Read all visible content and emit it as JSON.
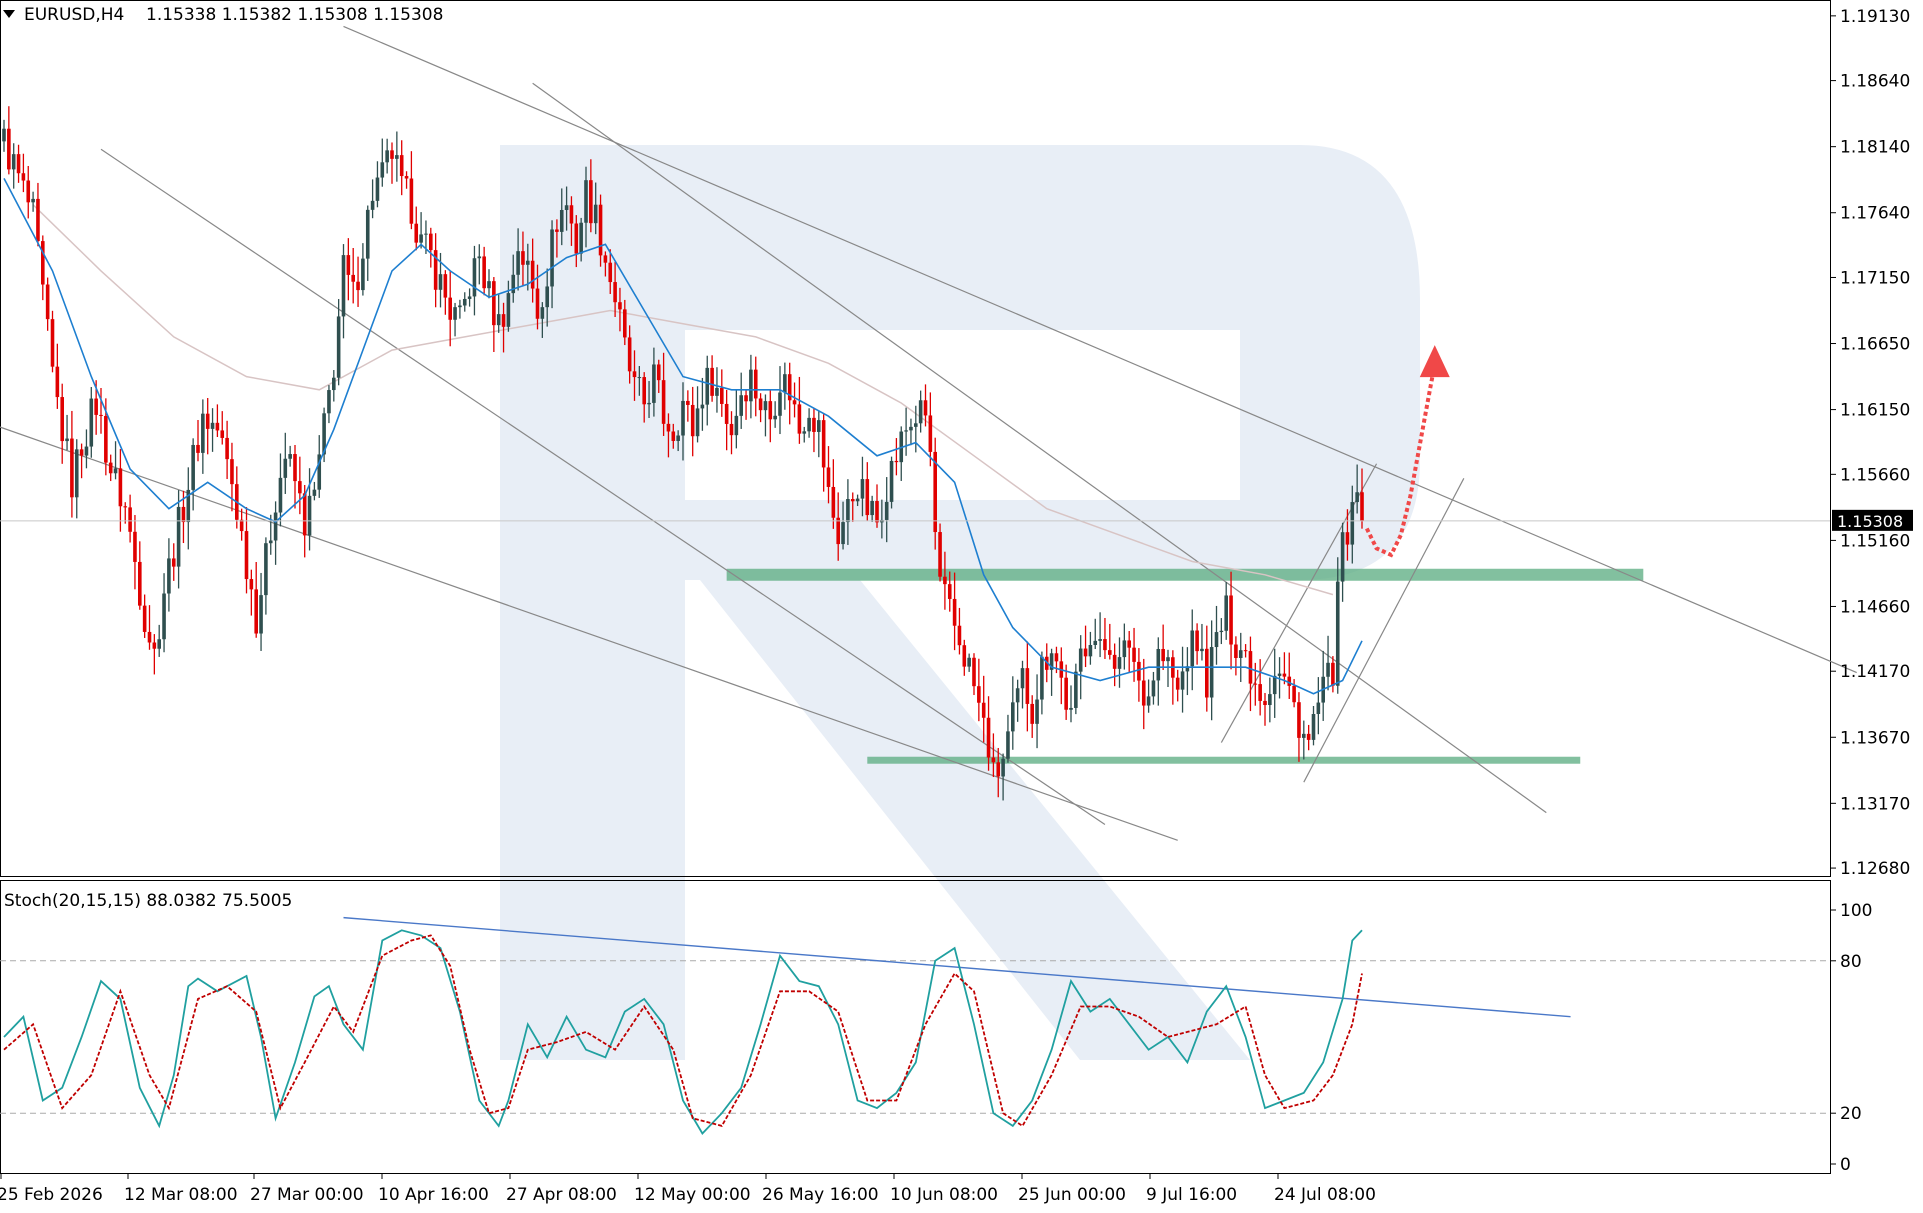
{
  "header": {
    "symbol": "EURUSD,H4",
    "ohlc": "1.15338 1.15382 1.15308 1.15308"
  },
  "colors": {
    "bull": "#2f4f4f",
    "bear": "#e00000",
    "ma_fast": "#1e7fd0",
    "ma_slow": "#d8c4c4",
    "zone": "#5fae84",
    "trend": "#888888",
    "forecast": "#f04848",
    "stoch_main": "#20a0a0",
    "stoch_signal": "#c00000",
    "stoch_trend": "#4a78c8",
    "watermark": "#e8eef6"
  },
  "chart_data": [
    {
      "type": "candlestick",
      "symbol": "EURUSD",
      "timeframe": "H4",
      "x_ticks": [
        "25 Feb 2026",
        "12 Mar 08:00",
        "27 Mar 00:00",
        "10 Apr 16:00",
        "27 Apr 08:00",
        "12 May 00:00",
        "26 May 16:00",
        "10 Jun 08:00",
        "25 Jun 00:00",
        "9 Jul 16:00",
        "24 Jul 08:00"
      ],
      "y_ticks": [
        "1.19130",
        "1.18640",
        "1.18140",
        "1.17640",
        "1.17150",
        "1.16650",
        "1.16150",
        "1.15660",
        "1.15160",
        "1.14660",
        "1.14170",
        "1.13670",
        "1.13170",
        "1.12680"
      ],
      "ylim": [
        1.1262,
        1.1925
      ],
      "current_price": "1.15308",
      "close_path": [
        [
          0,
          1.1818
        ],
        [
          3,
          1.179
        ],
        [
          6,
          1.176
        ],
        [
          8,
          1.17
        ],
        [
          10,
          1.164
        ],
        [
          12,
          1.16
        ],
        [
          14,
          1.156
        ],
        [
          16,
          1.159
        ],
        [
          19,
          1.162
        ],
        [
          22,
          1.157
        ],
        [
          25,
          1.154
        ],
        [
          27,
          1.15
        ],
        [
          29,
          1.146
        ],
        [
          31,
          1.143
        ],
        [
          33,
          1.148
        ],
        [
          35,
          1.151
        ],
        [
          38,
          1.156
        ],
        [
          41,
          1.161
        ],
        [
          44,
          1.16
        ],
        [
          47,
          1.156
        ],
        [
          50,
          1.15
        ],
        [
          52,
          1.146
        ],
        [
          54,
          1.15
        ],
        [
          56,
          1.155
        ],
        [
          58,
          1.158
        ],
        [
          60,
          1.156
        ],
        [
          62,
          1.153
        ],
        [
          64,
          1.155
        ],
        [
          66,
          1.16
        ],
        [
          68,
          1.165
        ],
        [
          70,
          1.172
        ],
        [
          72,
          1.17
        ],
        [
          74,
          1.174
        ],
        [
          76,
          1.178
        ],
        [
          78,
          1.179
        ],
        [
          80,
          1.181
        ],
        [
          82,
          1.178
        ],
        [
          84,
          1.177
        ],
        [
          86,
          1.174
        ],
        [
          88,
          1.173
        ],
        [
          90,
          1.171
        ],
        [
          92,
          1.169
        ],
        [
          94,
          1.168
        ],
        [
          96,
          1.171
        ],
        [
          98,
          1.173
        ],
        [
          100,
          1.17
        ],
        [
          102,
          1.168
        ],
        [
          104,
          1.17
        ],
        [
          106,
          1.174
        ],
        [
          108,
          1.172
        ],
        [
          110,
          1.169
        ],
        [
          112,
          1.172
        ],
        [
          114,
          1.176
        ],
        [
          116,
          1.177
        ],
        [
          118,
          1.174
        ],
        [
          120,
          1.178
        ],
        [
          122,
          1.176
        ],
        [
          124,
          1.173
        ],
        [
          126,
          1.17
        ],
        [
          128,
          1.166
        ],
        [
          130,
          1.163
        ],
        [
          132,
          1.162
        ],
        [
          134,
          1.164
        ],
        [
          136,
          1.161
        ],
        [
          138,
          1.16
        ],
        [
          140,
          1.162
        ],
        [
          142,
          1.16
        ],
        [
          144,
          1.163
        ],
        [
          146,
          1.164
        ],
        [
          148,
          1.162
        ],
        [
          150,
          1.16
        ],
        [
          152,
          1.163
        ],
        [
          154,
          1.164
        ],
        [
          156,
          1.162
        ],
        [
          158,
          1.161
        ],
        [
          160,
          1.164
        ],
        [
          162,
          1.163
        ],
        [
          164,
          1.16
        ],
        [
          166,
          1.162
        ],
        [
          168,
          1.16
        ],
        [
          170,
          1.155
        ],
        [
          172,
          1.152
        ],
        [
          174,
          1.154
        ],
        [
          176,
          1.156
        ],
        [
          178,
          1.154
        ],
        [
          180,
          1.153
        ],
        [
          182,
          1.156
        ],
        [
          184,
          1.158
        ],
        [
          186,
          1.16
        ],
        [
          188,
          1.161
        ],
        [
          190,
          1.161
        ],
        [
          191,
          1.158
        ],
        [
          192,
          1.152
        ],
        [
          193,
          1.148
        ],
        [
          195,
          1.146
        ],
        [
          197,
          1.144
        ],
        [
          199,
          1.142
        ],
        [
          201,
          1.139
        ],
        [
          203,
          1.136
        ],
        [
          204,
          1.1335
        ],
        [
          206,
          1.135
        ],
        [
          208,
          1.138
        ],
        [
          210,
          1.141
        ],
        [
          212,
          1.139
        ],
        [
          214,
          1.142
        ],
        [
          216,
          1.144
        ],
        [
          218,
          1.141
        ],
        [
          220,
          1.138
        ],
        [
          222,
          1.143
        ],
        [
          224,
          1.145
        ],
        [
          226,
          1.143
        ],
        [
          228,
          1.144
        ],
        [
          230,
          1.142
        ],
        [
          232,
          1.144
        ],
        [
          234,
          1.141
        ],
        [
          236,
          1.14
        ],
        [
          238,
          1.143
        ],
        [
          240,
          1.142
        ],
        [
          242,
          1.14
        ],
        [
          244,
          1.143
        ],
        [
          246,
          1.144
        ],
        [
          248,
          1.141
        ],
        [
          250,
          1.144
        ],
        [
          252,
          1.146
        ],
        [
          254,
          1.144
        ],
        [
          256,
          1.143
        ],
        [
          258,
          1.141
        ],
        [
          260,
          1.14
        ],
        [
          262,
          1.142
        ],
        [
          264,
          1.141
        ],
        [
          266,
          1.139
        ],
        [
          268,
          1.137
        ],
        [
          269,
          1.136
        ],
        [
          270,
          1.138
        ],
        [
          272,
          1.14
        ],
        [
          274,
          1.142
        ],
        [
          275,
          1.147
        ],
        [
          276,
          1.152
        ],
        [
          277,
          1.15
        ],
        [
          278,
          1.155
        ],
        [
          279,
          1.154
        ],
        [
          280,
          1.1531
        ]
      ],
      "ma_fast": [
        [
          0,
          1.179
        ],
        [
          10,
          1.172
        ],
        [
          18,
          1.164
        ],
        [
          26,
          1.157
        ],
        [
          34,
          1.154
        ],
        [
          42,
          1.156
        ],
        [
          50,
          1.154
        ],
        [
          56,
          1.153
        ],
        [
          62,
          1.155
        ],
        [
          68,
          1.16
        ],
        [
          74,
          1.166
        ],
        [
          80,
          1.172
        ],
        [
          86,
          1.174
        ],
        [
          92,
          1.172
        ],
        [
          100,
          1.17
        ],
        [
          108,
          1.171
        ],
        [
          116,
          1.173
        ],
        [
          124,
          1.174
        ],
        [
          132,
          1.169
        ],
        [
          140,
          1.164
        ],
        [
          150,
          1.163
        ],
        [
          160,
          1.163
        ],
        [
          170,
          1.161
        ],
        [
          180,
          1.158
        ],
        [
          188,
          1.159
        ],
        [
          196,
          1.156
        ],
        [
          202,
          1.149
        ],
        [
          208,
          1.145
        ],
        [
          216,
          1.142
        ],
        [
          226,
          1.141
        ],
        [
          236,
          1.142
        ],
        [
          246,
          1.142
        ],
        [
          256,
          1.142
        ],
        [
          264,
          1.141
        ],
        [
          270,
          1.14
        ],
        [
          276,
          1.141
        ],
        [
          280,
          1.144
        ]
      ],
      "ma_slow": [
        [
          6,
          1.177
        ],
        [
          20,
          1.172
        ],
        [
          35,
          1.167
        ],
        [
          50,
          1.164
        ],
        [
          65,
          1.163
        ],
        [
          80,
          1.166
        ],
        [
          95,
          1.167
        ],
        [
          110,
          1.168
        ],
        [
          125,
          1.169
        ],
        [
          140,
          1.168
        ],
        [
          155,
          1.167
        ],
        [
          170,
          1.165
        ],
        [
          185,
          1.162
        ],
        [
          200,
          1.158
        ],
        [
          215,
          1.154
        ],
        [
          230,
          1.152
        ],
        [
          245,
          1.15
        ],
        [
          260,
          1.149
        ],
        [
          274,
          1.1475
        ]
      ],
      "zones": [
        {
          "price": 1.149,
          "x_start": 149,
          "x_end": 338
        },
        {
          "price": 1.135,
          "x_start": 178,
          "x_end": 325
        }
      ],
      "trendlines": [
        {
          "from": [
            70,
            1.1905
          ],
          "to": [
            382,
            1.1416
          ]
        },
        {
          "from": [
            109,
            1.1862
          ],
          "to": [
            318,
            1.131
          ]
        },
        {
          "from": [
            20,
            1.1812
          ],
          "to": [
            227,
            1.1301
          ]
        },
        {
          "from": [
            -1,
            1.1602
          ],
          "to": [
            242,
            1.1289
          ]
        },
        {
          "from": [
            251,
            1.1363
          ],
          "to": [
            283,
            1.1574
          ]
        },
        {
          "from": [
            268,
            1.1333
          ],
          "to": [
            301,
            1.1563
          ]
        }
      ],
      "forecast_path": [
        [
          281,
          1.1525
        ],
        [
          283,
          1.151
        ],
        [
          286,
          1.1505
        ],
        [
          288,
          1.152
        ],
        [
          290,
          1.155
        ],
        [
          292,
          1.159
        ],
        [
          294,
          1.163
        ],
        [
          295,
          1.166
        ]
      ]
    },
    {
      "type": "line",
      "name": "Stoch(20,15,15) 88.0382 75.5005",
      "y_ticks": [
        "100",
        "80",
        "20",
        "0"
      ],
      "ylim": [
        0,
        100
      ],
      "levels": [
        80,
        20
      ],
      "main_line": [
        [
          0,
          50
        ],
        [
          4,
          58
        ],
        [
          8,
          25
        ],
        [
          12,
          30
        ],
        [
          16,
          50
        ],
        [
          20,
          72
        ],
        [
          24,
          65
        ],
        [
          28,
          30
        ],
        [
          32,
          15
        ],
        [
          35,
          35
        ],
        [
          38,
          70
        ],
        [
          40,
          73
        ],
        [
          44,
          68
        ],
        [
          46,
          70
        ],
        [
          50,
          74
        ],
        [
          53,
          50
        ],
        [
          56,
          18
        ],
        [
          60,
          40
        ],
        [
          64,
          66
        ],
        [
          67,
          70
        ],
        [
          70,
          55
        ],
        [
          74,
          45
        ],
        [
          78,
          88
        ],
        [
          82,
          92
        ],
        [
          86,
          90
        ],
        [
          90,
          85
        ],
        [
          94,
          60
        ],
        [
          98,
          25
        ],
        [
          102,
          15
        ],
        [
          104,
          25
        ],
        [
          108,
          55
        ],
        [
          112,
          42
        ],
        [
          116,
          58
        ],
        [
          120,
          45
        ],
        [
          124,
          42
        ],
        [
          128,
          60
        ],
        [
          132,
          65
        ],
        [
          136,
          55
        ],
        [
          140,
          25
        ],
        [
          144,
          12
        ],
        [
          148,
          20
        ],
        [
          152,
          30
        ],
        [
          156,
          55
        ],
        [
          160,
          82
        ],
        [
          164,
          72
        ],
        [
          168,
          70
        ],
        [
          172,
          55
        ],
        [
          176,
          25
        ],
        [
          180,
          22
        ],
        [
          184,
          28
        ],
        [
          188,
          40
        ],
        [
          192,
          80
        ],
        [
          196,
          85
        ],
        [
          200,
          55
        ],
        [
          204,
          20
        ],
        [
          208,
          15
        ],
        [
          212,
          25
        ],
        [
          216,
          45
        ],
        [
          220,
          72
        ],
        [
          224,
          60
        ],
        [
          228,
          65
        ],
        [
          232,
          55
        ],
        [
          236,
          45
        ],
        [
          240,
          50
        ],
        [
          244,
          40
        ],
        [
          248,
          60
        ],
        [
          252,
          70
        ],
        [
          256,
          50
        ],
        [
          260,
          22
        ],
        [
          264,
          25
        ],
        [
          268,
          28
        ],
        [
          272,
          40
        ],
        [
          276,
          65
        ],
        [
          278,
          88
        ],
        [
          280,
          92
        ]
      ],
      "signal_line": [
        [
          0,
          45
        ],
        [
          6,
          55
        ],
        [
          12,
          22
        ],
        [
          18,
          35
        ],
        [
          24,
          68
        ],
        [
          30,
          35
        ],
        [
          34,
          22
        ],
        [
          40,
          65
        ],
        [
          46,
          70
        ],
        [
          52,
          60
        ],
        [
          57,
          22
        ],
        [
          62,
          40
        ],
        [
          68,
          62
        ],
        [
          72,
          52
        ],
        [
          78,
          82
        ],
        [
          84,
          88
        ],
        [
          88,
          90
        ],
        [
          92,
          78
        ],
        [
          96,
          45
        ],
        [
          100,
          20
        ],
        [
          104,
          22
        ],
        [
          108,
          45
        ],
        [
          114,
          48
        ],
        [
          120,
          52
        ],
        [
          126,
          45
        ],
        [
          132,
          62
        ],
        [
          138,
          45
        ],
        [
          142,
          18
        ],
        [
          148,
          15
        ],
        [
          154,
          35
        ],
        [
          160,
          68
        ],
        [
          166,
          68
        ],
        [
          172,
          60
        ],
        [
          178,
          25
        ],
        [
          184,
          25
        ],
        [
          190,
          55
        ],
        [
          196,
          75
        ],
        [
          200,
          68
        ],
        [
          206,
          20
        ],
        [
          210,
          15
        ],
        [
          216,
          35
        ],
        [
          222,
          62
        ],
        [
          228,
          62
        ],
        [
          234,
          58
        ],
        [
          240,
          50
        ],
        [
          244,
          52
        ],
        [
          250,
          55
        ],
        [
          256,
          62
        ],
        [
          260,
          35
        ],
        [
          264,
          22
        ],
        [
          270,
          25
        ],
        [
          274,
          35
        ],
        [
          278,
          55
        ],
        [
          280,
          75
        ]
      ],
      "trendline": {
        "from": [
          70,
          97
        ],
        "to": [
          323,
          58
        ]
      }
    }
  ]
}
